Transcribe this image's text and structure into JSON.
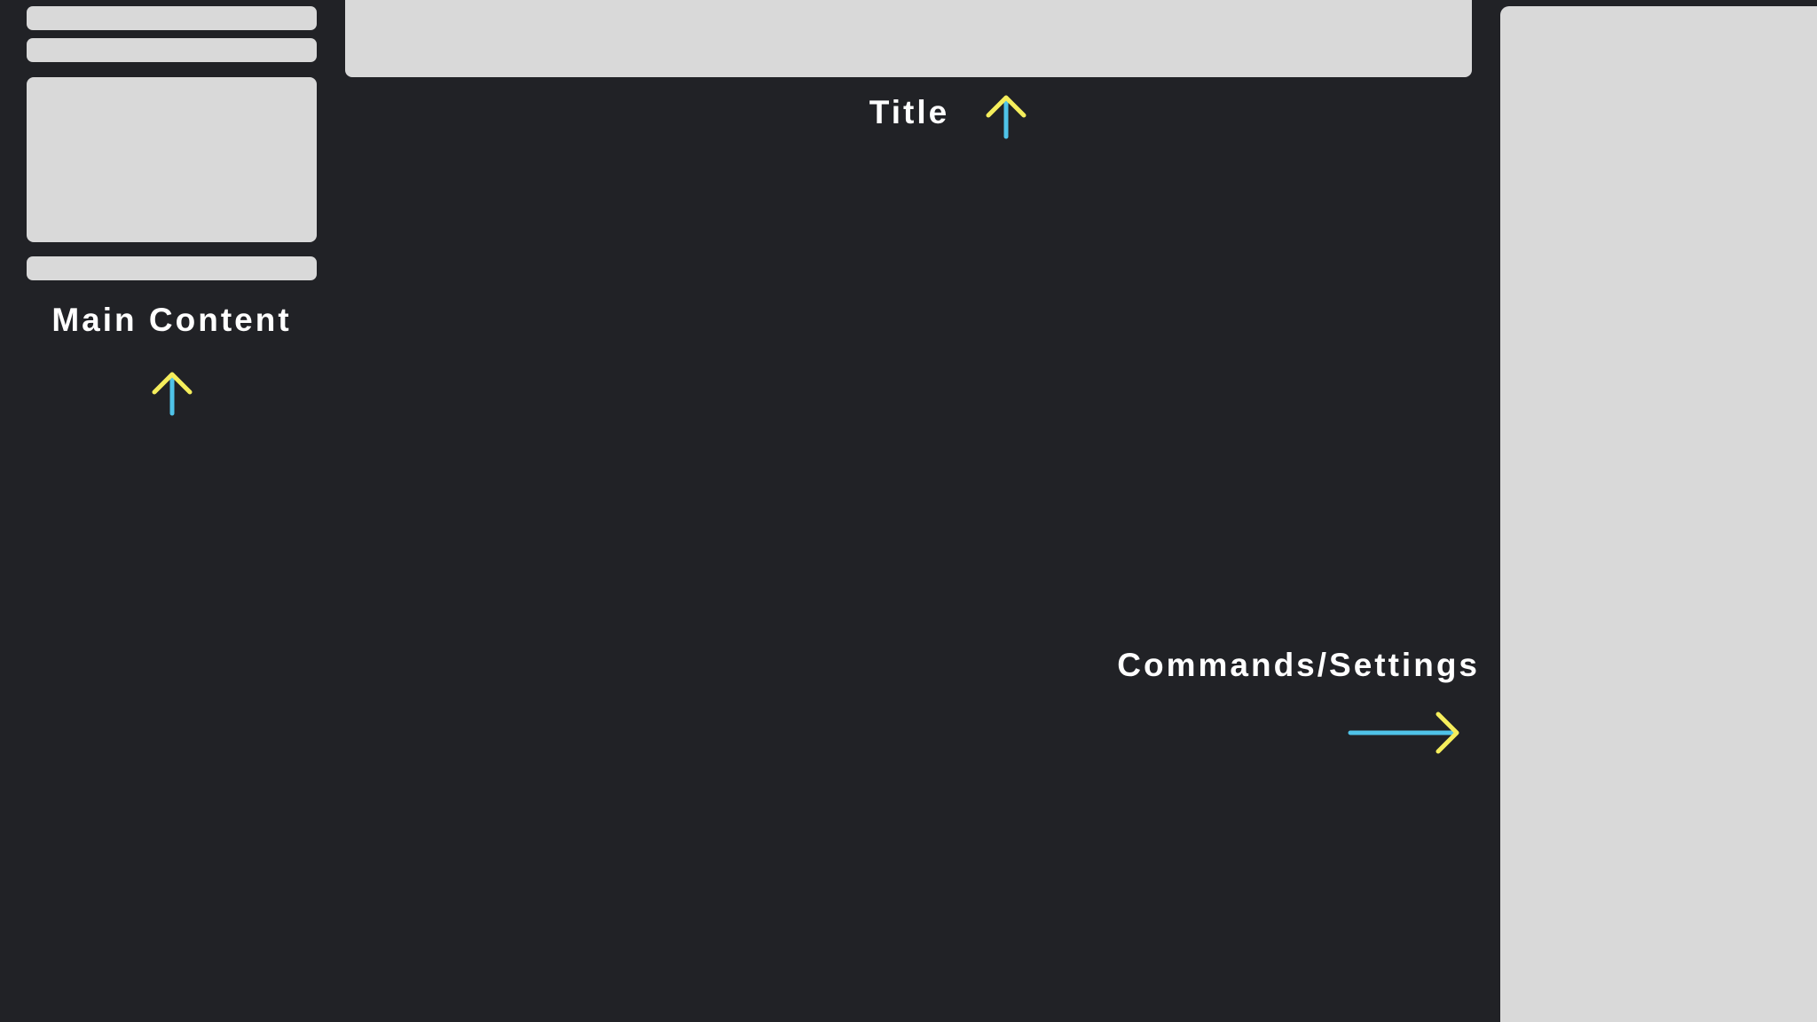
{
  "labels": {
    "title": "Title",
    "main_content": "Main Content",
    "commands_settings": "Commands/Settings"
  },
  "icons": {
    "title_arrow": "arrow-up-icon",
    "main_content_arrow": "arrow-up-icon",
    "commands_arrow": "arrow-right-icon"
  },
  "colors": {
    "background": "#212226",
    "placeholder": "#d9d9d9",
    "label_text": "#ffffff",
    "arrow_shaft": "#4fc3e8",
    "arrow_head": "#f5ee5c"
  }
}
